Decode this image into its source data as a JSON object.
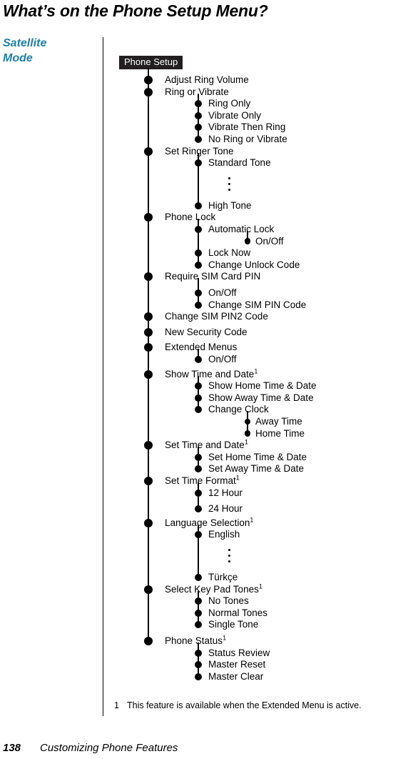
{
  "page": {
    "title": "What’s on the Phone Setup Menu?",
    "side_heading_lines": [
      "Satellite",
      "Mode"
    ],
    "side_heading_color": "#1f7fa8",
    "footnote_number": "1",
    "footnote_text": "This feature is available when the Extended Menu is active.",
    "footer_page_number": "138",
    "footer_title": "Customizing Phone Features"
  },
  "menu": {
    "root_label": "Phone Setup",
    "items": [
      {
        "label": "Adjust Ring Volume",
        "level": 1
      },
      {
        "label": "Ring or Vibrate",
        "level": 1
      },
      {
        "label": "Ring Only",
        "level": 2
      },
      {
        "label": "Vibrate Only",
        "level": 2
      },
      {
        "label": "Vibrate Then Ring",
        "level": 2
      },
      {
        "label": "No Ring or Vibrate",
        "level": 2
      },
      {
        "label": "Set Ringer Tone",
        "level": 1
      },
      {
        "label": "Standard Tone",
        "level": 2
      },
      {
        "label": "High Tone",
        "level": 2
      },
      {
        "label": "Phone Lock",
        "level": 1
      },
      {
        "label": "Automatic Lock",
        "level": 2
      },
      {
        "label": "On/Off",
        "level": 3
      },
      {
        "label": "Lock Now",
        "level": 2
      },
      {
        "label": "Change Unlock Code",
        "level": 2
      },
      {
        "label": "Require SIM Card PIN",
        "level": 1
      },
      {
        "label": "On/Off",
        "level": 2
      },
      {
        "label": "Change SIM PIN Code",
        "level": 2
      },
      {
        "label": "Change SIM PIN2 Code",
        "level": 1
      },
      {
        "label": "New Security Code",
        "level": 1
      },
      {
        "label": "Extended Menus",
        "level": 1
      },
      {
        "label": "On/Off",
        "level": 2
      },
      {
        "label": "Show Time and Date",
        "level": 1,
        "footnote": "1"
      },
      {
        "label": "Show Home Time & Date",
        "level": 2
      },
      {
        "label": "Show Away Time & Date",
        "level": 2
      },
      {
        "label": "Change Clock",
        "level": 2
      },
      {
        "label": "Away Time",
        "level": 3
      },
      {
        "label": "Home Time",
        "level": 3
      },
      {
        "label": "Set Time and Date",
        "level": 1,
        "footnote": "1"
      },
      {
        "label": "Set Home Time & Date",
        "level": 2
      },
      {
        "label": "Set Away Time & Date",
        "level": 2
      },
      {
        "label": "Set Time Format",
        "level": 1,
        "footnote": "1"
      },
      {
        "label": "12 Hour",
        "level": 2
      },
      {
        "label": "24 Hour",
        "level": 2
      },
      {
        "label": "Language Selection",
        "level": 1,
        "footnote": "1"
      },
      {
        "label": "English",
        "level": 2
      },
      {
        "label": "Türkçe",
        "level": 2
      },
      {
        "label": "Select Key Pad Tones",
        "level": 1,
        "footnote": "1"
      },
      {
        "label": "No Tones",
        "level": 2
      },
      {
        "label": "Normal Tones",
        "level": 2
      },
      {
        "label": "Single Tone",
        "level": 2
      },
      {
        "label": "Phone Status",
        "level": 1,
        "footnote": "1"
      },
      {
        "label": "Status Review",
        "level": 2
      },
      {
        "label": "Master Reset",
        "level": 2
      },
      {
        "label": "Master Clear",
        "level": 2
      }
    ]
  }
}
